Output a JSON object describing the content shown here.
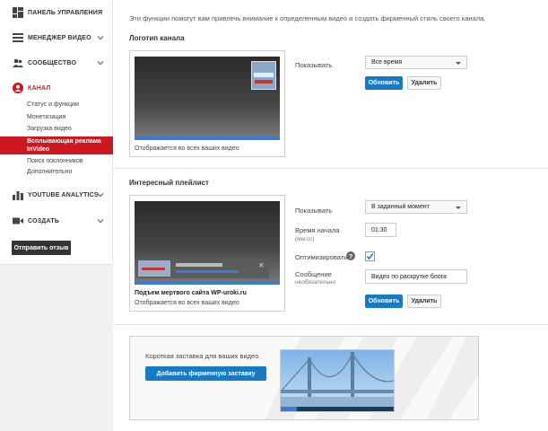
{
  "sidebar": {
    "items": [
      {
        "label": "ПАНЕЛЬ УПРАВЛЕНИЯ"
      },
      {
        "label": "МЕНЕДЖЕР ВИДЕО"
      },
      {
        "label": "СООБЩЕСТВО"
      },
      {
        "label": "КАНАЛ"
      },
      {
        "label": "YOUTUBE ANALYTICS"
      },
      {
        "label": "СОЗДАТЬ"
      }
    ],
    "channel_subitems": [
      "Статус и функции",
      "Монетизация",
      "Загрузка видео",
      "Поиск поклонников",
      "Дополнительно"
    ],
    "active_subitem": "Всплывающая реклама InVideo",
    "feedback_button": "Отправить отзыв"
  },
  "main": {
    "intro": "Эти функции помогут вам привлечь внимание к определенным видео и создать фирменный стиль своего канала.",
    "logo": {
      "title": "Логотип канала",
      "caption": "Отображается во всех ваших видео",
      "show_label": "Показывать",
      "show_value": "Все время",
      "update": "Обновить",
      "delete": "Удалить"
    },
    "playlist": {
      "title": "Интересный плейлист",
      "video_title": "Подъем мертвого сайта WP-uroki.ru",
      "caption": "Отображается во всех ваших видео",
      "show_label": "Показывать",
      "show_value": "В заданный момент",
      "start_label": "Время начала",
      "start_hint": "(мм:сс)",
      "start_value": "01:30",
      "optimize_label": "Оптимизировать",
      "message_label": "Сообщение",
      "message_hint": "необязательно",
      "message_value": "Видео по раскрутке блога",
      "update": "Обновить",
      "delete": "Удалить"
    },
    "intro_card": {
      "text": "Короткая заставка для ваших видео.",
      "button": "Добавить фирменную заставку"
    }
  },
  "colors": {
    "accent": "#cc181e",
    "blue": "#167ac6"
  }
}
